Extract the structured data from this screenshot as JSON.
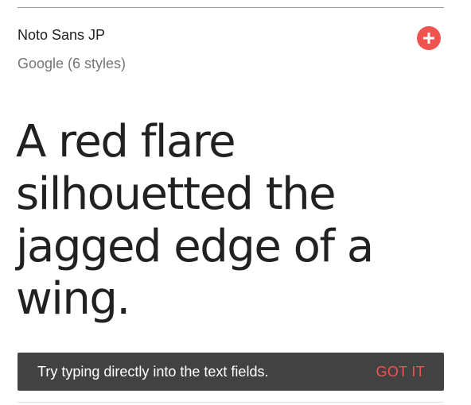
{
  "font_card": {
    "name": "Noto Sans JP",
    "foundry_styles": "Google (6 styles)",
    "add_icon": "plus-circle-icon",
    "accent_color": "#ef5350",
    "preview_text": "A red flare silhouetted the jagged edge of a wing."
  },
  "snackbar": {
    "message": "Try typing directly into the text fields.",
    "action_label": "GOT IT"
  }
}
